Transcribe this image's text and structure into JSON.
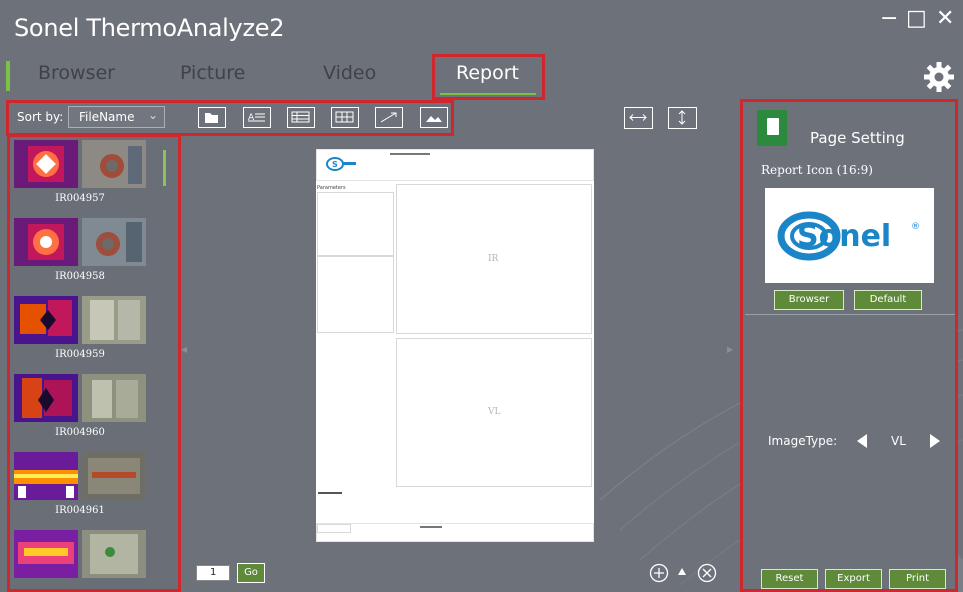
{
  "app": {
    "title": "Sonel ThermoAnalyze2",
    "window_controls": {
      "minimize": "−",
      "maximize": "□",
      "close": "✕"
    }
  },
  "tabs": [
    {
      "label": "Browser",
      "active": false
    },
    {
      "label": "Picture",
      "active": false
    },
    {
      "label": "Video",
      "active": false
    },
    {
      "label": "Report",
      "active": true
    }
  ],
  "toolbar": {
    "sort_label": "Sort by:",
    "sort_value": "FileName",
    "icons": [
      "open-folder-icon",
      "text-block-icon",
      "table-icon",
      "grid-table-icon",
      "line-chart-icon",
      "image-icon"
    ],
    "fit_icons": [
      "fit-width-icon",
      "fit-height-icon"
    ]
  },
  "thumbnails": [
    {
      "name": "IR004957"
    },
    {
      "name": "IR004958"
    },
    {
      "name": "IR004959"
    },
    {
      "name": "IR004960"
    },
    {
      "name": "IR004961"
    },
    {
      "name": ""
    }
  ],
  "preview": {
    "ir_label": "IR",
    "vl_label": "VL",
    "parameters_label": "Parameters",
    "page_number": "1",
    "go_label": "Go"
  },
  "page_setting": {
    "title": "Page Setting",
    "report_icon_label": "Report Icon (16:9)",
    "logo_text": "Sonel",
    "browser_button": "Browser",
    "default_button": "Default",
    "image_type_label": "ImageType:",
    "image_type_value": "VL",
    "reset_button": "Reset",
    "export_button": "Export",
    "print_button": "Print"
  },
  "colors": {
    "background": "#6d7179",
    "accent_green": "#7cc243",
    "button_green": "#5e8a3a",
    "highlight_red": "#d0262d",
    "logo_blue": "#1a86c8"
  }
}
